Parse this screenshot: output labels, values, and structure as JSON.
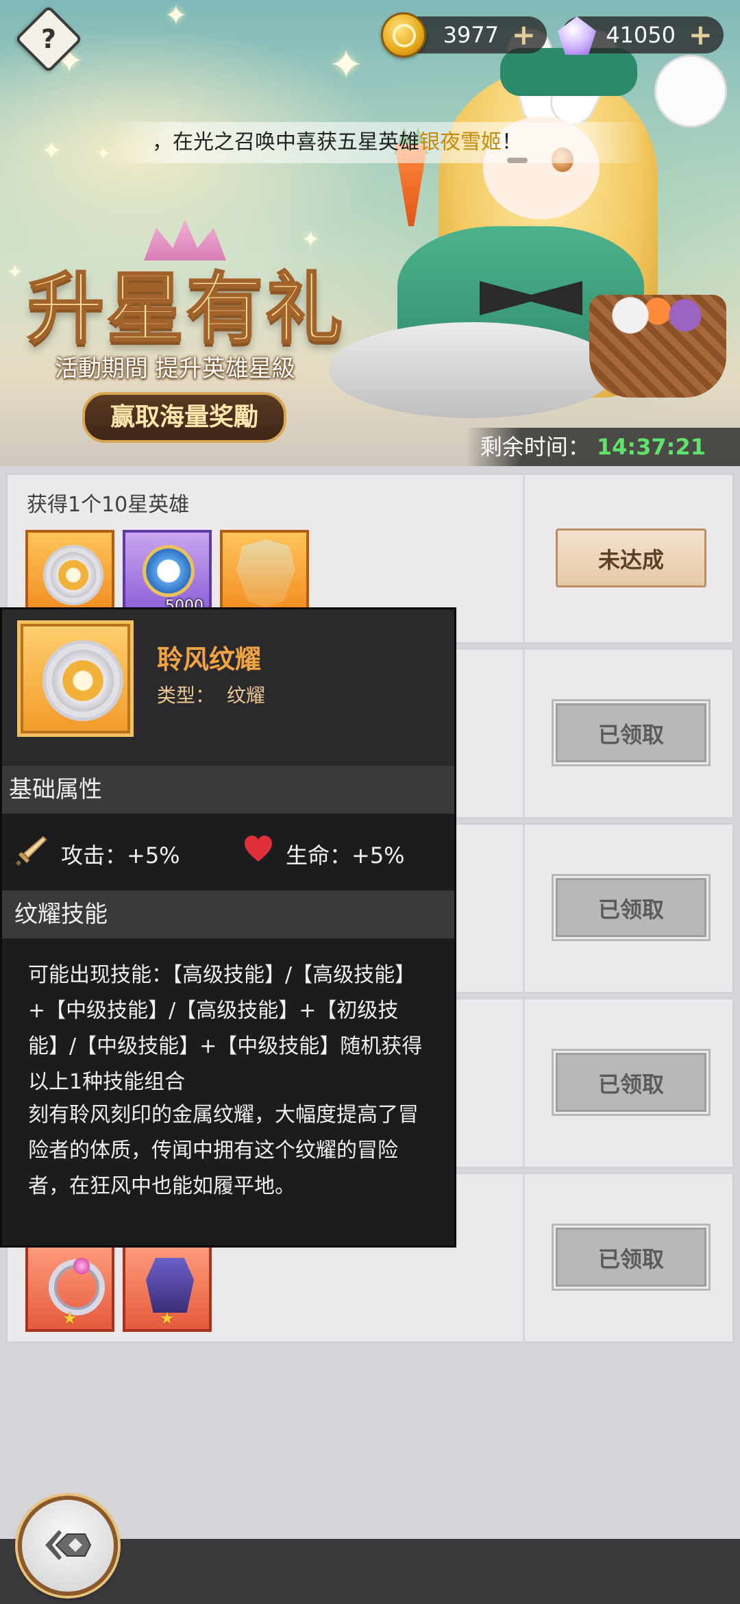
{
  "header": {
    "gold": {
      "icon": "gold-coin-icon",
      "value": "3977",
      "add": "+"
    },
    "gems": {
      "icon": "diamond-icon",
      "value": "41050",
      "add": "+"
    },
    "help_icon": "?"
  },
  "broadcast": {
    "prefix": "，在光之召唤中喜获五星英雄",
    "hero": "银夜雪姬",
    "suffix": "！"
  },
  "banner": {
    "title": "升星有礼",
    "subtitle": "活動期間 提升英雄星級",
    "badge": "赢取海量奖勵",
    "timer_label": "剩余时间：",
    "timer_value": "14:37:21"
  },
  "tasks": [
    {
      "title": "获得1个10星英雄",
      "button": "未达成",
      "items": [
        {
          "icon": "emblem-icon",
          "qty": ""
        },
        {
          "icon": "star-medal-icon",
          "qty": "5000"
        },
        {
          "icon": "shield-icon",
          "qty": ""
        }
      ]
    },
    {
      "title": "",
      "button": "已领取"
    },
    {
      "title": "",
      "button": "已领取"
    },
    {
      "title": "",
      "button": "已领取"
    },
    {
      "title": "",
      "button": "已领取",
      "items": [
        {
          "icon": "ring-icon",
          "qty": ""
        },
        {
          "icon": "armor-icon",
          "qty": ""
        }
      ]
    }
  ],
  "tooltip": {
    "name": "聆风纹耀",
    "type_label": "类型：",
    "type_value": "纹耀",
    "base_title": "基础属性",
    "attack_label": "攻击：+5%",
    "hp_label": "生命：+5%",
    "skill_title": "纹耀技能",
    "skill_text": "可能出现技能：【高级技能】/【高级技能】+【中级技能】/【高级技能】+【初级技能】/【中级技能】+【中级技能】随机获得以上1种技能组合",
    "lore_text": "刻有聆风刻印的金属纹耀，大幅度提高了冒险者的体质，传闻中拥有这个纹耀的冒险者，在狂风中也能如履平地。"
  }
}
